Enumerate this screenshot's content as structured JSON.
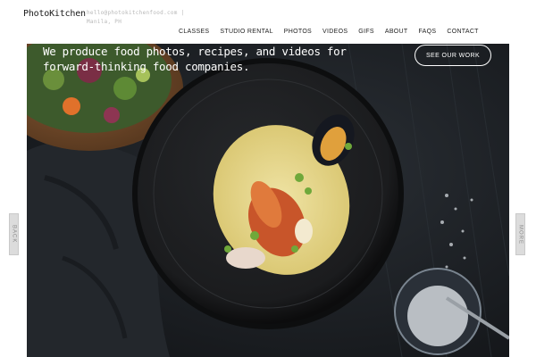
{
  "header": {
    "logo": "PhotoKitchen",
    "contact": "hello@photokitchenfood.com | Manila, PH"
  },
  "nav": {
    "items": [
      {
        "label": "CLASSES"
      },
      {
        "label": "STUDIO RENTAL"
      },
      {
        "label": "PHOTOS"
      },
      {
        "label": "VIDEOS"
      },
      {
        "label": "GIFS"
      },
      {
        "label": "ABOUT"
      },
      {
        "label": "FAQS"
      },
      {
        "label": "CONTACT"
      }
    ]
  },
  "hero": {
    "tagline_line1": "We produce food photos, recipes, and videos for",
    "tagline_line2": "forward-thinking food companies.",
    "cta_label": "SEE OUR WORK"
  },
  "side_nav": {
    "back_label": "BACK",
    "more_label": "MORE"
  }
}
